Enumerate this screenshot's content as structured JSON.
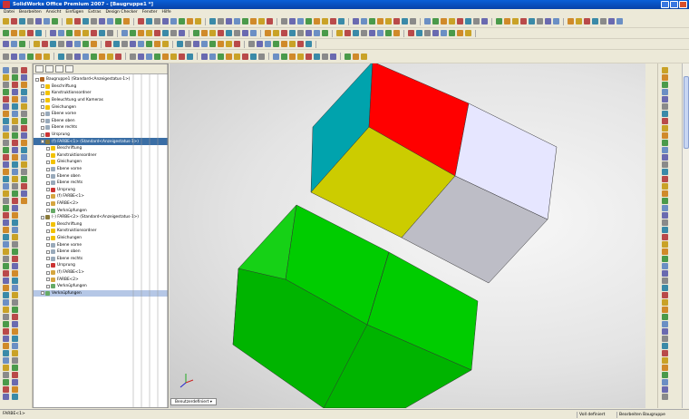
{
  "window": {
    "title": "SolidWorks Office Premium 2007 - [Baugruppe1 *]"
  },
  "menu": [
    "Datei",
    "Bearbeiten",
    "Ansicht",
    "Einfügen",
    "Extras",
    "Design Checker",
    "Fenster",
    "Hilfe"
  ],
  "tree": {
    "items": [
      {
        "label": "Baugruppe1 (Standard<Anzeigestatus-1>)",
        "indent": 0,
        "icon": "#b5651d"
      },
      {
        "label": "Beschriftung",
        "indent": 1,
        "icon": "#f2c200"
      },
      {
        "label": "Konstruktionsordner",
        "indent": 1,
        "icon": "#f2c200"
      },
      {
        "label": "Beleuchtung und Kameras",
        "indent": 1,
        "icon": "#f2c200"
      },
      {
        "label": "Gleichungen",
        "indent": 1,
        "icon": "#f2c200"
      },
      {
        "label": "Ebene vorne",
        "indent": 1,
        "icon": "#9ab"
      },
      {
        "label": "Ebene oben",
        "indent": 1,
        "icon": "#9ab"
      },
      {
        "label": "Ebene rechts",
        "indent": 1,
        "icon": "#9ab"
      },
      {
        "label": "Ursprung",
        "indent": 1,
        "icon": "#c33"
      },
      {
        "label": "(f) FARBE<1> (Standard<Anzeigestatus-1>)",
        "indent": 1,
        "icon": "#8a7a3a",
        "selected": true
      },
      {
        "label": "Beschriftung",
        "indent": 2,
        "icon": "#f2c200"
      },
      {
        "label": "Konstruktionsordner",
        "indent": 2,
        "icon": "#f2c200"
      },
      {
        "label": "Gleichungen",
        "indent": 2,
        "icon": "#f2c200"
      },
      {
        "label": "Ebene vorne",
        "indent": 2,
        "icon": "#9ab"
      },
      {
        "label": "Ebene oben",
        "indent": 2,
        "icon": "#9ab"
      },
      {
        "label": "Ebene rechts",
        "indent": 2,
        "icon": "#9ab"
      },
      {
        "label": "Ursprung",
        "indent": 2,
        "icon": "#c33"
      },
      {
        "label": "(f) FARBE<1>",
        "indent": 2,
        "icon": "#d6a640"
      },
      {
        "label": "FARBE<2>",
        "indent": 2,
        "icon": "#d6a640"
      },
      {
        "label": "Verknüpfungen",
        "indent": 2,
        "icon": "#6a6"
      },
      {
        "label": "(-) FARBE<2> (Standard<Anzeigestatus-1>)",
        "indent": 1,
        "icon": "#8a7a3a"
      },
      {
        "label": "Beschriftung",
        "indent": 2,
        "icon": "#f2c200"
      },
      {
        "label": "Konstruktionsordner",
        "indent": 2,
        "icon": "#f2c200"
      },
      {
        "label": "Gleichungen",
        "indent": 2,
        "icon": "#f2c200"
      },
      {
        "label": "Ebene vorne",
        "indent": 2,
        "icon": "#9ab"
      },
      {
        "label": "Ebene oben",
        "indent": 2,
        "icon": "#9ab"
      },
      {
        "label": "Ebene rechts",
        "indent": 2,
        "icon": "#9ab"
      },
      {
        "label": "Ursprung",
        "indent": 2,
        "icon": "#c33"
      },
      {
        "label": "(f) FARBE<1>",
        "indent": 2,
        "icon": "#d6a640"
      },
      {
        "label": "FARBE<2>",
        "indent": 2,
        "icon": "#d6a640"
      },
      {
        "label": "Verknüpfungen",
        "indent": 2,
        "icon": "#6a6"
      },
      {
        "label": "Verknüpfungen",
        "indent": 1,
        "icon": "#6a6",
        "highlight": true
      }
    ]
  },
  "viewport": {
    "tab_label": "Benutzerdefiniert"
  },
  "status": {
    "left": "FARBE<1>",
    "mid": "Voll definiert",
    "right": "Bearbeiten Baugruppe"
  },
  "colors": {
    "red": "#ff0000",
    "teal": "#00a3ad",
    "lavender": "#e6e6ff",
    "yellow": "#cccc00",
    "gray": "#bdbdc6",
    "green": "#00cc00",
    "green_dark": "#00b400",
    "green_side": "#16d116"
  }
}
